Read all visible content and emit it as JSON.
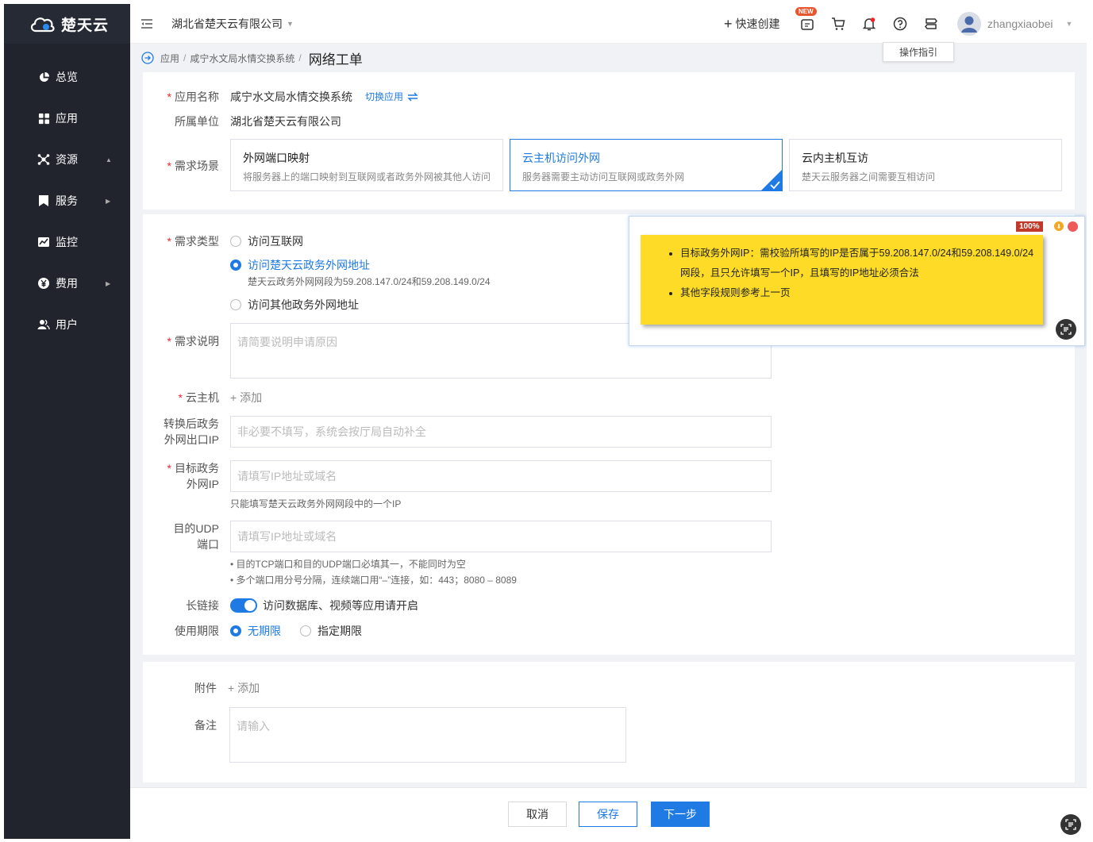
{
  "app": {
    "brand": "楚天云"
  },
  "sidebar": {
    "items": [
      {
        "label": "总览",
        "icon": "pie-chart-icon"
      },
      {
        "label": "应用",
        "icon": "grid-icon"
      },
      {
        "label": "资源",
        "icon": "network-icon",
        "arrow": "▲"
      },
      {
        "label": "服务",
        "icon": "bookmark-icon",
        "arrow": "▶"
      },
      {
        "label": "监控",
        "icon": "monitor-chart-icon"
      },
      {
        "label": "费用",
        "icon": "yen-icon",
        "arrow": "▶"
      },
      {
        "label": "用户",
        "icon": "user-icon"
      }
    ]
  },
  "header": {
    "org": "湖北省楚天云有限公司",
    "quick_create": "快速创建",
    "new_badge": "NEW",
    "username": "zhangxiaobei",
    "tooltip": "操作指引"
  },
  "breadcrumb": {
    "items": [
      "应用",
      "咸宁水文局水情交换系统"
    ],
    "current": "网络工单"
  },
  "form": {
    "app_name_label": "应用名称",
    "app_name_value": "咸宁水文局水情交换系统",
    "switch_app": "切换应用",
    "unit_label": "所属单位",
    "unit_value": "湖北省楚天云有限公司",
    "scene_label": "需求场景",
    "scenes": [
      {
        "title": "外网端口映射",
        "desc": "将服务器上的端口映射到互联网或者政务外网被其他人访问"
      },
      {
        "title": "云主机访问外网",
        "desc": "服务器需要主动访问互联网或政务外网",
        "selected": true
      },
      {
        "title": "云内主机互访",
        "desc": "楚天云服务器之间需要互相访问"
      }
    ],
    "type_label": "需求类型",
    "types": [
      {
        "label": "访问互联网"
      },
      {
        "label": "访问楚天云政务外网地址",
        "selected": true,
        "hint": "楚天云政务外网网段为59.208.147.0/24和59.208.149.0/24"
      },
      {
        "label": "访问其他政务外网地址"
      }
    ],
    "desc_label": "需求说明",
    "desc_placeholder": "请简要说明申请原因",
    "vm_label": "云主机",
    "vm_add": "+ 添加",
    "nat_label_1": "转换后政务",
    "nat_label_2": "外网出口IP",
    "nat_placeholder": "非必要不填写，系统会按厅局自动补全",
    "target_label_1": "目标政务",
    "target_label_2": "外网IP",
    "target_placeholder": "请填写IP地址或域名",
    "target_hint": "只能填写楚天云政务外网网段中的一个IP",
    "udp_label_1": "目的UDP",
    "udp_label_2": "端口",
    "udp_placeholder": "请填写IP地址或域名",
    "udp_hints": [
      "• 目的TCP端口和目的UDP端口必填其一，不能同时为空",
      "• 多个端口用分号分隔，连续端口用“–”连接，如：443；8080 – 8089"
    ],
    "keepalive_label": "长链接",
    "keepalive_text": "访问数据库、视频等应用请开启",
    "keepalive_on": true,
    "period_label": "使用期限",
    "periods": [
      {
        "label": "无期限",
        "selected": true
      },
      {
        "label": "指定期限"
      }
    ],
    "attach_label": "附件",
    "attach_add": "+ 添加",
    "remark_label": "备注",
    "remark_placeholder": "请输入"
  },
  "footer": {
    "cancel": "取消",
    "save": "保存",
    "next": "下一步"
  },
  "popup": {
    "zoom": "100%",
    "notes": [
      "目标政务外网IP：需校验所填写的IP是否属于59.208.147.0/24和59.208.149.0/24网段，且只允许填写一个IP，且填写的IP地址必须合法",
      "其他字段规则参考上一页"
    ]
  },
  "colors": {
    "primary": "#1f7ae3",
    "sidebar": "#21242d",
    "note": "#fddb27",
    "required": "#f5222d"
  }
}
